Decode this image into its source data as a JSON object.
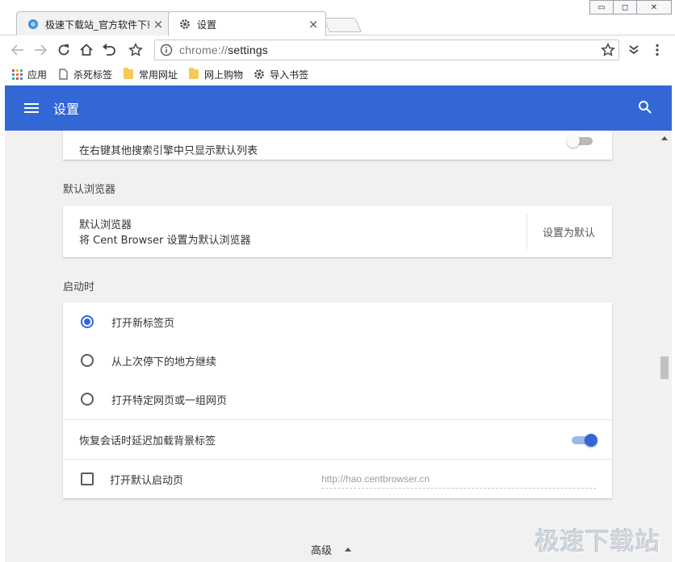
{
  "tabs": [
    {
      "title": "极速下载站_官方软件下载",
      "icon": "site-favicon",
      "close": "×",
      "active": false
    },
    {
      "title": "设置",
      "icon": "gear-icon",
      "close": "×",
      "active": true
    }
  ],
  "window_controls": {
    "minimize": "▭",
    "restore": "◻",
    "close": "✕"
  },
  "toolbar": {
    "url_scheme": "chrome://",
    "url_path": "settings"
  },
  "bookmarks": [
    {
      "label": "应用",
      "icon": "apps-grid-icon"
    },
    {
      "label": "杀死标签",
      "icon": "page-icon"
    },
    {
      "label": "常用网址",
      "icon": "folder-icon"
    },
    {
      "label": "网上购物",
      "icon": "folder-icon"
    },
    {
      "label": "导入书签",
      "icon": "gear-icon"
    }
  ],
  "header": {
    "title": "设置"
  },
  "search": {
    "only_default_label": "在右键其他搜索引擎中只显示默认列表",
    "only_default_enabled": false
  },
  "default_browser": {
    "section_title": "默认浏览器",
    "label": "默认浏览器",
    "sublabel": "将 Cent Browser 设置为默认浏览器",
    "action_label": "设置为默认"
  },
  "startup": {
    "section_title": "启动时",
    "options": [
      {
        "label": "打开新标签页",
        "checked": true
      },
      {
        "label": "从上次停下的地方继续",
        "checked": false
      },
      {
        "label": "打开特定网页或一组网页",
        "checked": false
      }
    ],
    "lazy_load_label": "恢复会话时延迟加载背景标签",
    "lazy_load_enabled": true,
    "open_default_label": "打开默认启动页",
    "open_default_checked": false,
    "default_url_placeholder": "http://hao.centbrowser.cn"
  },
  "advanced_label": "高级",
  "watermark": "极速下载站",
  "colors": {
    "accent": "#3367d6",
    "background": "#f1f1f1"
  }
}
